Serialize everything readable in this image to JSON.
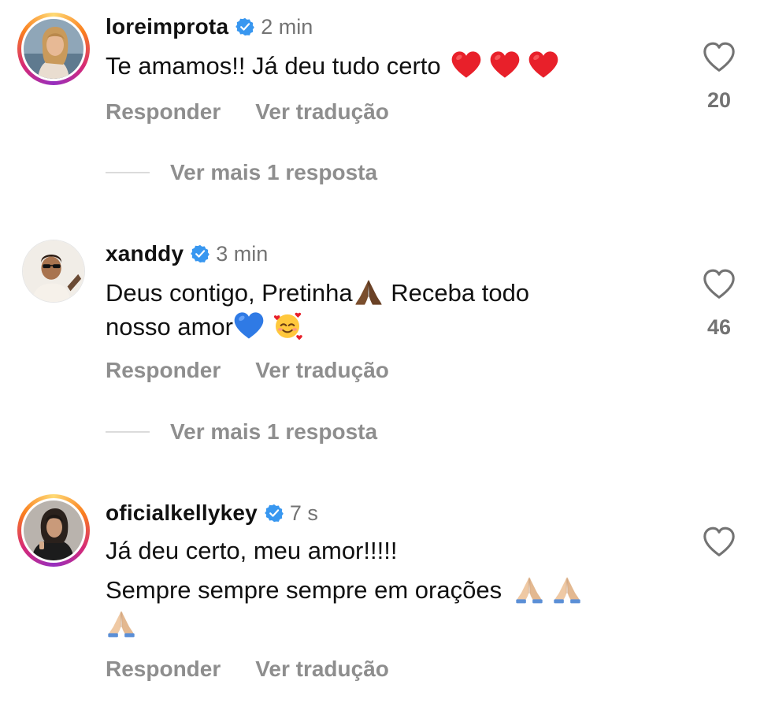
{
  "comments": [
    {
      "username": "loreimprota",
      "verified_icon": "verified-badge-icon",
      "time": "2 min",
      "lines": [
        "Te amamos!! Já deu tudo certo"
      ],
      "emojis": [
        "red-heart",
        "red-heart",
        "red-heart"
      ],
      "reply_label": "Responder",
      "translate_label": "Ver tradução",
      "likes": "20",
      "more_replies": "Ver mais 1 resposta",
      "story_ring": true
    },
    {
      "username": "xanddy",
      "verified_icon": "verified-badge-icon",
      "time": "3 min",
      "line1_a": "Deus contigo, Pretinha",
      "line1_b": " Receba todo",
      "line2": "nosso amor",
      "reply_label": "Responder",
      "translate_label": "Ver tradução",
      "likes": "46",
      "more_replies": "Ver mais 1 resposta",
      "story_ring": false
    },
    {
      "username": "oficialkellykey",
      "verified_icon": "verified-badge-icon",
      "time": "7 s",
      "line1": "Já deu certo, meu amor!!!!!",
      "line2": "Sempre sempre sempre em orações ",
      "reply_label": "Responder",
      "translate_label": "Ver tradução",
      "story_ring": true
    }
  ],
  "colors": {
    "verified_blue": "#3897f0",
    "secondary_text": "#8e8e8e",
    "heart_red": "#e8202a",
    "heart_blue": "#2f7ae5"
  }
}
